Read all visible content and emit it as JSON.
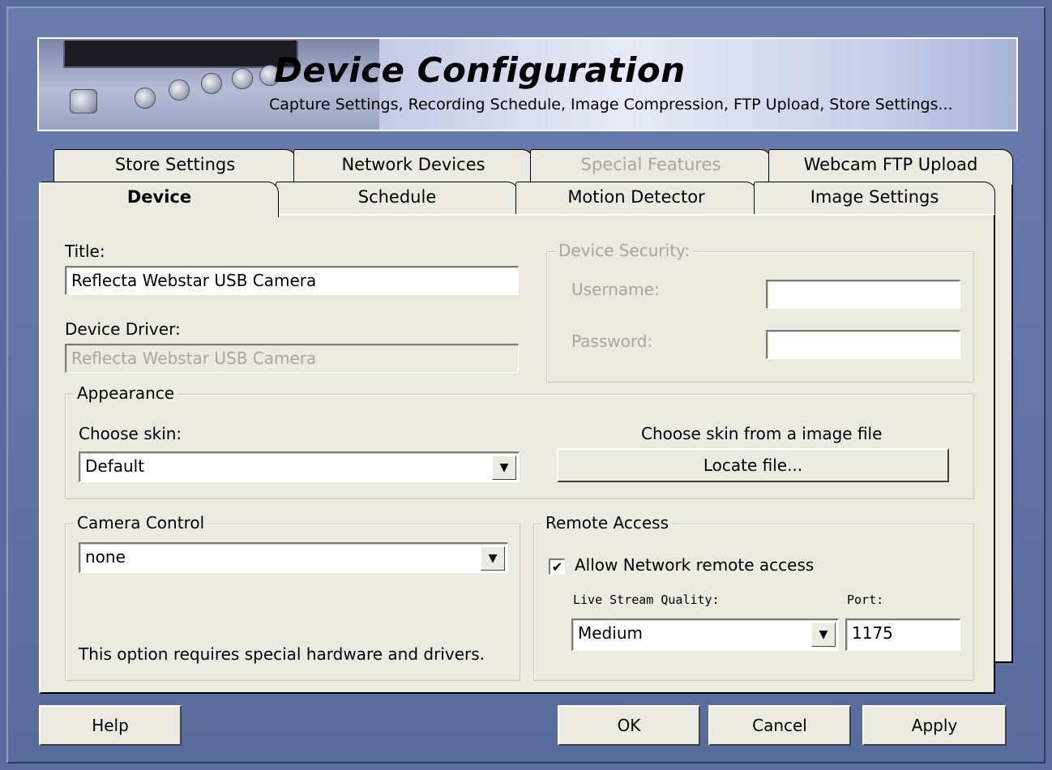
{
  "header": {
    "title": "Device Configuration",
    "subtitle": "Capture Settings, Recording Schedule,  Image Compression, FTP Upload, Store Settings..."
  },
  "tabs_back": [
    {
      "label": "Store Settings",
      "enabled": true
    },
    {
      "label": "Network Devices",
      "enabled": true
    },
    {
      "label": "Special Features",
      "enabled": false
    },
    {
      "label": "Webcam FTP Upload",
      "enabled": true
    }
  ],
  "tabs_front": [
    {
      "label": "Device",
      "active": true
    },
    {
      "label": "Schedule",
      "active": false
    },
    {
      "label": "Motion Detector",
      "active": false
    },
    {
      "label": "Image Settings",
      "active": false
    }
  ],
  "device": {
    "title_label": "Title:",
    "title_value": "Reflecta Webstar USB Camera",
    "driver_label": "Device Driver:",
    "driver_value": "Reflecta Webstar USB Camera"
  },
  "security": {
    "group_label": "Device Security:",
    "username_label": "Username:",
    "username_value": "",
    "password_label": "Password:",
    "password_value": ""
  },
  "appearance": {
    "group_label": "Appearance",
    "skin_label": "Choose skin:",
    "skin_value": "Default",
    "file_label": "Choose skin from a image file",
    "locate_button": "Locate file..."
  },
  "camera_control": {
    "group_label": "Camera Control",
    "value": "none",
    "note": "This option requires special hardware and drivers."
  },
  "remote_access": {
    "group_label": "Remote Access",
    "allow_label": "Allow Network remote access",
    "allow_checked": true,
    "checkmark": "✔",
    "quality_label": "Live Stream Quality:",
    "quality_value": "Medium",
    "port_label": "Port:",
    "port_value": "1175"
  },
  "footer": {
    "help": "Help",
    "ok": "OK",
    "cancel": "Cancel",
    "apply": "Apply"
  },
  "icons": {
    "dropdown": "▼"
  }
}
